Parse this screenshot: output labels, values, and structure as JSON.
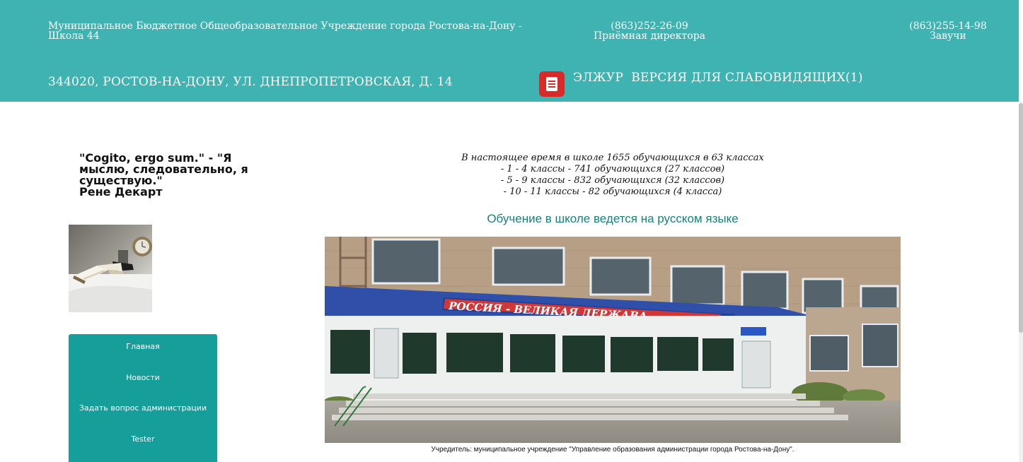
{
  "header": {
    "school_name": "Муниципальное Бюджетное Общеобразовательное Учреждение города Ростова-на-Дону - Школа 44",
    "phone1": {
      "number": "(863)252-26-09",
      "label": "Приёмная директора"
    },
    "phone2": {
      "number": "(863)255-14-98",
      "label": "Завучи"
    },
    "address": "344020, РОСТОВ-НА-ДОНУ, УЛ. ДНЕПРОПЕТРОВСКАЯ, Д. 14",
    "links": [
      "ЭЛЖУР",
      "ВЕРСИЯ ДЛЯ СЛАБОВИДЯЩИХ(1)"
    ]
  },
  "sidebar": {
    "quote_lines": [
      "\"Cogito, ergo sum.\" - \"Я",
      "мыслю, следовательно, я",
      "существую.\"",
      "Рене Декарт"
    ],
    "menu": [
      "Главная",
      "Новости",
      "Задать вопрос администрации",
      "Tester"
    ]
  },
  "main": {
    "stats_lines": [
      "В настоящее время в школе 1655 обучающихся в 63 классах",
      "- 1 - 4 классы - 741 обучающихся (27 классов)",
      "- 5 - 9 классы - 832 обучающихся (32 классов)",
      "- 10 - 11 классы - 82 обучающихся (4 класса)"
    ],
    "language_note": "Обучение в школе ведется на русском языке",
    "banner_text": "РОССИЯ - ВЕЛИКАЯ ДЕРЖАВА",
    "founder": "Учредитель: муниципальное учреждение \"Управление образования администрации города Ростова-на-Дону\"."
  },
  "colors": {
    "header_bg": "#3fb3b1",
    "menu_bg": "#169e9b",
    "accent_text": "#17807e",
    "doc_icon": "#d92a2a"
  }
}
